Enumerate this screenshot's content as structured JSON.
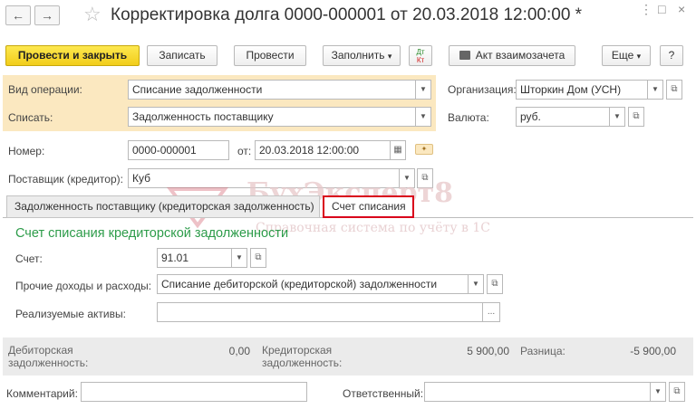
{
  "window": {
    "title": "Корректировка долга 0000-000001 от 20.03.2018 12:00:00 *",
    "back_glyph": "←",
    "forward_glyph": "→",
    "star_glyph": "☆",
    "kebab_glyph": "⋮",
    "maximize_glyph": "□",
    "close_glyph": "×"
  },
  "toolbar": {
    "post_close": "Провести и закрыть",
    "save": "Записать",
    "post": "Провести",
    "fill": "Заполнить",
    "dtkt_top": "Дт",
    "dtkt_bottom": "Кт",
    "act": "Акт взаимозачета",
    "more": "Еще",
    "help": "?",
    "dropdown_glyph": "▾"
  },
  "form": {
    "operation_label": "Вид операции:",
    "operation_value": "Списание задолженности",
    "writeoff_label": "Списать:",
    "writeoff_value": "Задолженность поставщику",
    "org_label": "Организация:",
    "org_value": "Шторкин Дом (УСН)",
    "currency_label": "Валюта:",
    "currency_value": "руб.",
    "number_label": "Номер:",
    "number_value": "0000-000001",
    "date_label": "от:",
    "date_value": "20.03.2018 12:00:00",
    "supplier_label": "Поставщик (кредитор):",
    "supplier_value": "Куб",
    "open_glyph": "⧉",
    "select_glyph": "...",
    "calendar_glyph": "▦"
  },
  "tabs": [
    {
      "label": "Задолженность поставщику (кредиторская задолженность)"
    },
    {
      "label": "Счет списания"
    }
  ],
  "section": {
    "title": "Счет списания кредиторской задолженности",
    "account_label": "Счет:",
    "account_value": "91.01",
    "other_label": "Прочие доходы и расходы:",
    "other_value": "Списание дебиторской (кредиторской) задолженности",
    "assets_label": "Реализуемые активы:",
    "assets_value": ""
  },
  "totals": {
    "debit_label_1": "Дебиторская",
    "debit_label_2": "задолженность:",
    "debit_value": "0,00",
    "credit_label_1": "Кредиторская",
    "credit_label_2": "задолженность:",
    "credit_value": "5 900,00",
    "diff_label": "Разница:",
    "diff_value": "-5 900,00"
  },
  "footer": {
    "comment_label": "Комментарий:",
    "comment_value": "",
    "responsible_label": "Ответственный:",
    "responsible_value": ""
  },
  "watermark": {
    "brand": "БухЭксперт8",
    "tagline": "Справочная система по учёту в 1С"
  },
  "colors": {
    "primary_button": "#f2cd1a",
    "highlight": "#fbe8c0",
    "active_tab_border": "#d9001b",
    "section_title": "#2d9c4a"
  }
}
